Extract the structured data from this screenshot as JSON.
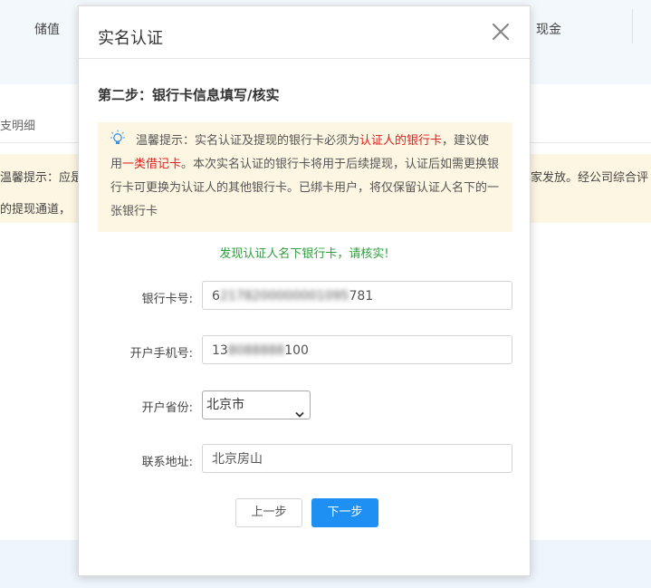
{
  "background": {
    "nav_left": "储值",
    "nav_right": "现金",
    "tab": "支明细",
    "notice_line1": "温馨提示：应是",
    "notice_line2": "的提现通道，",
    "notice_right": "家发放。经公司综合评"
  },
  "modal": {
    "title": "实名认证",
    "step_title": "第二步：银行卡信息填写/核实",
    "tip": {
      "prefix": "温馨提示：实名认证及提现的银行卡必须为",
      "red1": "认证人的银行卡",
      "mid1": "，建议使用",
      "red2": "一类借记卡",
      "suffix": "。本次实名认证的银行卡将用于后续提现，认证后如需更换银行卡可更换为认证人的其他银行卡。已绑卡用户，将仅保留认证人名下的一张银行卡"
    },
    "found_message": "发现认证人名下银行卡，请核实!",
    "form": {
      "card_label": "银行卡号:",
      "card_visible_prefix": "6",
      "card_blurred": "2178200000001095",
      "card_visible_suffix": "781",
      "phone_label": "开户手机号:",
      "phone_visible_prefix": "13",
      "phone_blurred": "8088888",
      "phone_visible_suffix": "100",
      "province_label": "开户省份:",
      "province_value": "北京市",
      "address_label": "联系地址:",
      "address_value": "北京房山"
    },
    "buttons": {
      "prev": "上一步",
      "next": "下一步"
    }
  },
  "colors": {
    "primary": "#1e8ff3",
    "warning_bg": "#fdf6e2",
    "highlight_red": "#e02020",
    "success_green": "#2e9e3e"
  }
}
